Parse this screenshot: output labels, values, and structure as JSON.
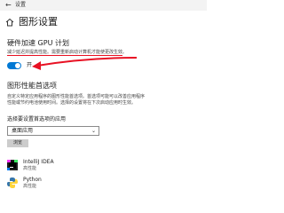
{
  "window": {
    "app_title": "设置"
  },
  "header": {
    "title": "图形设置"
  },
  "gpu_scheduling": {
    "heading": "硬件加速 GPU 计划",
    "description": "减少延迟并提高性能。需要重新启动计算机才能使更改生效。",
    "toggle_state": "开",
    "toggle_on": true,
    "accent_color": "#0078d4",
    "annotation_color": "#e81123"
  },
  "graphics_performance": {
    "heading": "图形性能首选项",
    "description_line1": "自定义特定应用程序的图形性能首选项。首选项可能可以改善应用程序",
    "description_line2": "性能或节约电池使用时间。选择的设置将在下次启动应用时生效。",
    "select_label": "选择要设置首选项的应用",
    "select_value": "桌面应用",
    "browse_label": "浏览"
  },
  "apps": [
    {
      "name": "IntelliJ IDEA",
      "mode": "高性能",
      "icon": "intellij-idea-icon"
    },
    {
      "name": "Python",
      "mode": "高性能",
      "icon": "python-icon"
    }
  ]
}
